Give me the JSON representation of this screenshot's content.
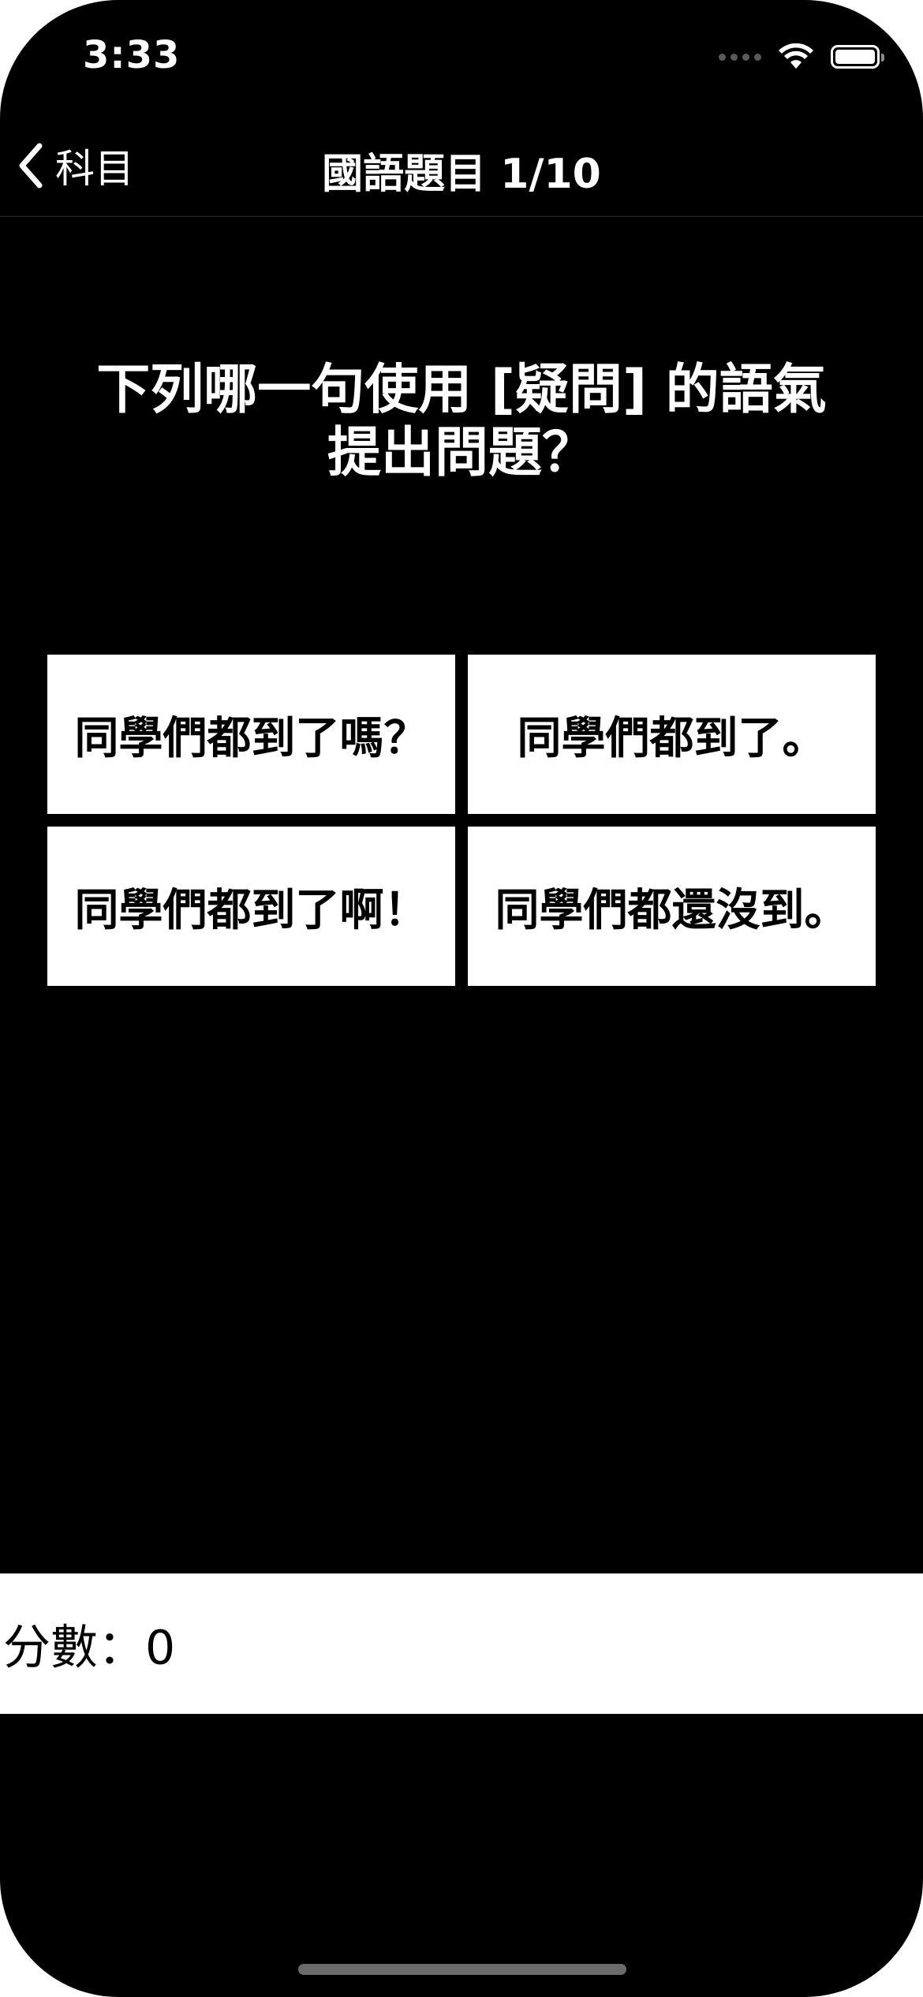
{
  "status_bar": {
    "time": "3:33"
  },
  "nav": {
    "back_label": "科目",
    "title": "國語題目 1/10"
  },
  "quiz": {
    "question_line1": "下列哪一句使用 [疑問] 的語氣",
    "question_line2": "提出問題？",
    "options": [
      "同學們都到了嗎？",
      "同學們都到了。",
      "同學們都到了啊！",
      "同學們都還沒到。"
    ]
  },
  "score": {
    "text": "分數：0"
  },
  "icons": {
    "back": "chevron-left-icon",
    "signal": "cellular-signal-icon",
    "wifi": "wifi-icon",
    "battery": "battery-icon"
  },
  "colors": {
    "background": "#000000",
    "surface": "#ffffff",
    "text_on_dark": "#ffffff",
    "text_on_light": "#000000"
  }
}
